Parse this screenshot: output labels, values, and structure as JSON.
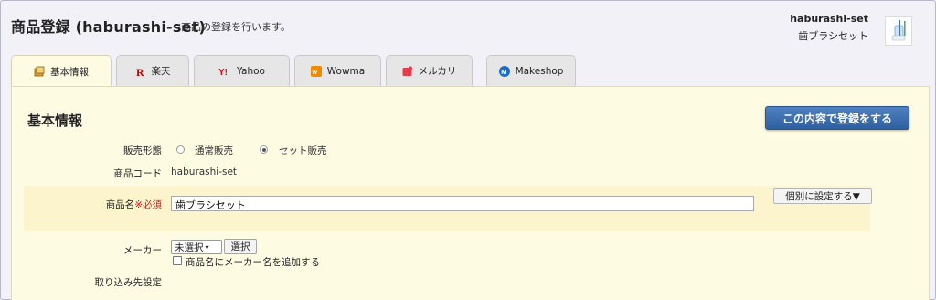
{
  "header": {
    "title": "商品登録 (haburashi-set)",
    "subtitle": "商品の登録を行います。",
    "product_code": "haburashi-set",
    "product_name": "歯ブラシセット"
  },
  "tabs": [
    {
      "label": "基本情報",
      "icon": "basic-info-icon",
      "active": true
    },
    {
      "label": "楽天",
      "icon": "rakuten-icon",
      "active": false
    },
    {
      "label": "Yahoo",
      "icon": "yahoo-icon",
      "active": false
    },
    {
      "label": "Wowma",
      "icon": "wowma-icon",
      "active": false
    },
    {
      "label": "メルカリ",
      "icon": "mercari-icon",
      "active": false
    },
    {
      "label": "Makeshop",
      "icon": "makeshop-icon",
      "active": false
    }
  ],
  "section": {
    "title": "基本情報",
    "submit_label": "この内容で登録をする"
  },
  "form": {
    "sales_type": {
      "label": "販売形態",
      "options": [
        "通常販売",
        "セット販売"
      ],
      "selected": "セット販売"
    },
    "product_code": {
      "label": "商品コード",
      "value": "haburashi-set"
    },
    "product_name": {
      "label": "商品名",
      "required": "※必須",
      "value": "歯ブラシセット",
      "individual_button": "個別に設定する▼"
    },
    "maker": {
      "label": "メーカー",
      "selected": "未選択",
      "select_button": "選択",
      "checkbox_label": "商品名にメーカー名を追加する"
    },
    "import_target": {
      "label": "取り込み先設定"
    }
  },
  "colors": {
    "panel_bg": "#fefbe3",
    "highlight_row": "#fbf4cc",
    "primary_button": "#3a6aab",
    "required": "#d01919"
  }
}
